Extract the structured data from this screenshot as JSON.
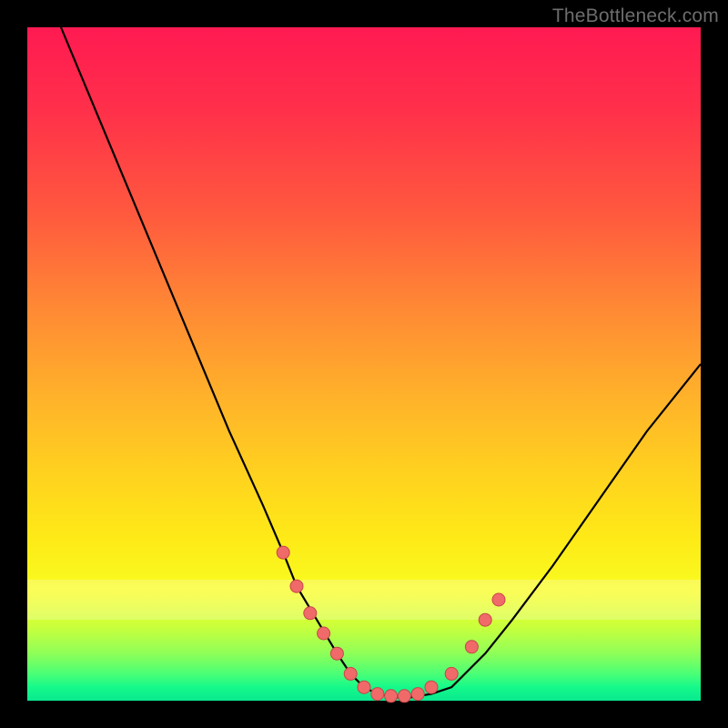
{
  "watermark": "TheBottleneck.com",
  "colors": {
    "watermark": "#7a7a7a",
    "curve_stroke": "#000000",
    "marker_fill": "#f06a6a",
    "marker_stroke": "#c64848",
    "frame_bg": "#000000"
  },
  "chart_data": {
    "type": "line",
    "title": "",
    "xlabel": "",
    "ylabel": "",
    "xlim": [
      0,
      100
    ],
    "ylim": [
      0,
      100
    ],
    "grid": false,
    "legend": false,
    "note": "Values estimated from pixel positions; axes are implicit (0–100) since no ticks are visible.",
    "series": [
      {
        "name": "curve",
        "x": [
          5,
          10,
          15,
          20,
          25,
          30,
          35,
          38,
          40,
          43,
          46,
          48,
          50,
          52,
          55,
          57,
          60,
          63,
          65,
          68,
          72,
          78,
          85,
          92,
          100
        ],
        "y": [
          100,
          88,
          76,
          64,
          52,
          40,
          29,
          22,
          17,
          12,
          7,
          4,
          2,
          1,
          0.5,
          0.5,
          1,
          2,
          4,
          7,
          12,
          20,
          30,
          40,
          50
        ]
      }
    ],
    "markers": {
      "name": "highlighted-points",
      "color": "#f06a6a",
      "x": [
        38,
        40,
        42,
        44,
        46,
        48,
        50,
        52,
        54,
        56,
        58,
        60,
        63,
        66,
        68,
        70
      ],
      "y": [
        22,
        17,
        13,
        10,
        7,
        4,
        2,
        1,
        0.7,
        0.7,
        1,
        2,
        4,
        8,
        12,
        15
      ]
    },
    "bands": [
      {
        "name": "pale-yellow-band",
        "y_from": 12,
        "y_to": 18
      }
    ]
  }
}
